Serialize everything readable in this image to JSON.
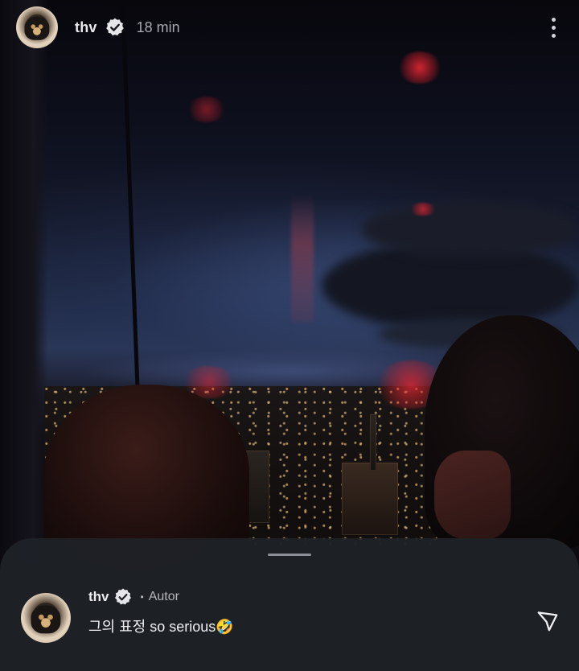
{
  "header": {
    "username": "thv",
    "verified_icon": "verified-badge-icon",
    "timestamp": "18 min",
    "more_icon": "more-vertical-icon"
  },
  "comments": [
    {
      "username": "thv",
      "separator": "•",
      "role_tag": "Autor",
      "text": "그의 표정 so serious🤣",
      "avatar_icon": "pomeranian-avatar"
    }
  ],
  "sheet": {
    "send_icon": "send-icon"
  },
  "colors": {
    "sheet_bg": "#1e2127",
    "text_primary": "#f0f0f2",
    "text_secondary": "#a8a8b0"
  }
}
